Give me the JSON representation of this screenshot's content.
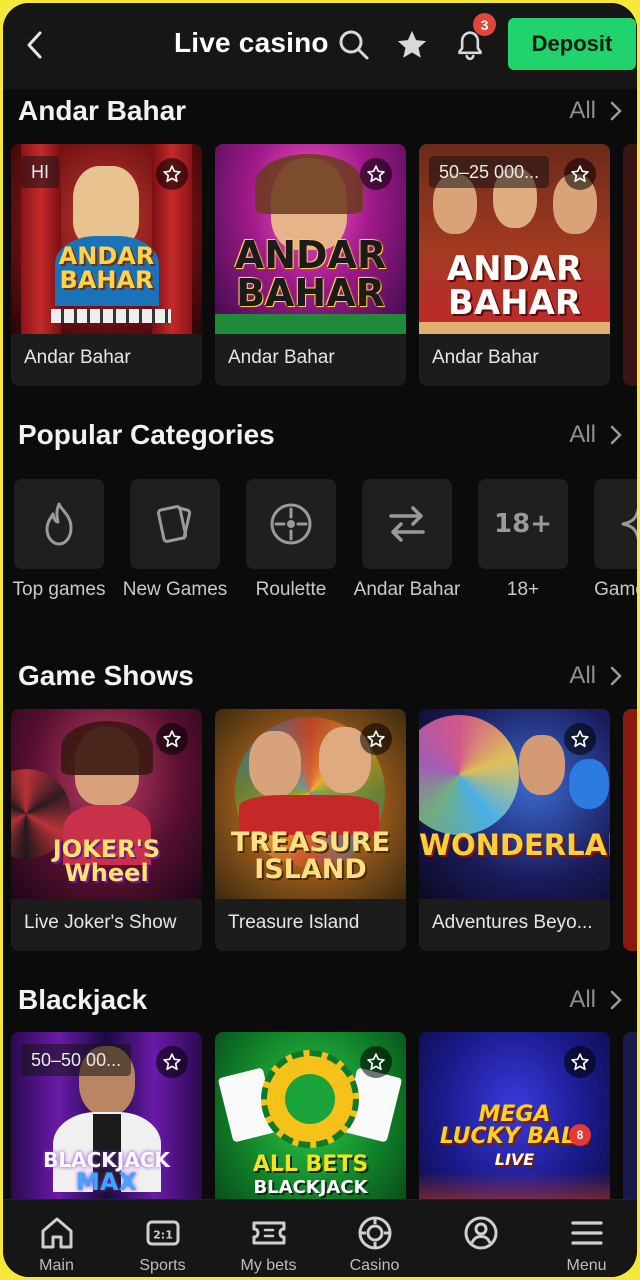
{
  "header": {
    "title": "Live casino",
    "deposit_label": "Deposit",
    "notification_count": "3",
    "icons": [
      "back-arrow-icon",
      "search-icon",
      "star-icon",
      "bell-icon"
    ]
  },
  "sections": {
    "andar_bahar": {
      "title": "Andar Bahar",
      "all_label": "All",
      "games": [
        {
          "name": "Andar Bahar",
          "badge": "HI",
          "logo": "ANDAR BAHAR"
        },
        {
          "name": "Andar Bahar",
          "badge": "",
          "logo": "ANDAR BAHAR"
        },
        {
          "name": "Andar Bahar",
          "badge": "50–25 000...",
          "logo": "ANDAR BAHAR"
        }
      ]
    },
    "popular": {
      "title": "Popular Categories",
      "all_label": "All",
      "categories": [
        {
          "label": "Top games",
          "icon": "flame-icon"
        },
        {
          "label": "New Games",
          "icon": "cards-icon"
        },
        {
          "label": "Roulette",
          "icon": "roulette-icon"
        },
        {
          "label": "Andar Bahar",
          "icon": "swap-arrows-icon"
        },
        {
          "label": "18+",
          "icon": "eighteen-plus-icon"
        },
        {
          "label": "Game Hits",
          "icon": "sparkle-icon"
        }
      ]
    },
    "game_shows": {
      "title": "Game Shows",
      "all_label": "All",
      "games": [
        {
          "name": "Live Joker's Show",
          "logo": "JOKER'S Wheel"
        },
        {
          "name": "Treasure Island",
          "logo": "TREASURE ISLAND"
        },
        {
          "name": "Adventures Beyo...",
          "logo": "WONDERLAND"
        }
      ]
    },
    "blackjack": {
      "title": "Blackjack",
      "all_label": "All",
      "games": [
        {
          "name": "",
          "badge": "50–50 00...",
          "logo": "BLACKJACK MAX"
        },
        {
          "name": "",
          "badge": "",
          "logo": "ALL BETS BLACKJACK"
        },
        {
          "name": "",
          "badge": "",
          "logo": "MEGA LUCKY BALL LIVE"
        }
      ]
    }
  },
  "bottom_nav": [
    {
      "label": "Main",
      "icon": "home-icon"
    },
    {
      "label": "Sports",
      "icon": "scoreboard-icon"
    },
    {
      "label": "My bets",
      "icon": "ticket-icon"
    },
    {
      "label": "Casino",
      "icon": "chip-icon"
    },
    {
      "label": "",
      "icon": "profile-icon"
    },
    {
      "label": "Menu",
      "icon": "hamburger-icon"
    }
  ],
  "colors": {
    "accent": "#20d36c",
    "badge": "#e2453b",
    "background": "#0b0b0b",
    "card": "#1c1c1c",
    "frame": "#f5e83a"
  }
}
